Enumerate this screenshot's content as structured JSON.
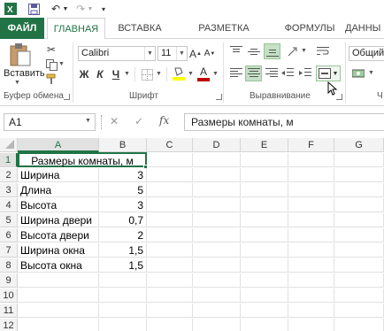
{
  "tabs": {
    "file": "ФАЙЛ",
    "home": "ГЛАВНАЯ",
    "insert": "ВСТАВКА",
    "page_layout": "РАЗМЕТКА СТРАНИЦЫ",
    "formulas": "ФОРМУЛЫ",
    "data": "ДАННЫ"
  },
  "ribbon": {
    "paste_label": "Вставить",
    "clipboard_group": "Буфер обмена",
    "font_group": "Шрифт",
    "alignment_group": "Выравнивание",
    "font_name": "Calibri",
    "font_size": "11",
    "font_grow": "A",
    "font_shrink": "A",
    "bold": "Ж",
    "italic": "К",
    "underline": "Ч",
    "font_color_letter": "A",
    "number_format": "Общий",
    "number_group_initial": "Ч"
  },
  "formula_bar": {
    "name_box": "A1",
    "fx": "fx",
    "cancel": "✕",
    "enter": "✓",
    "content": "Размеры комнаты, м"
  },
  "sheet": {
    "columns": [
      "A",
      "B",
      "C",
      "D",
      "E",
      "F",
      "G"
    ],
    "rows": [
      "1",
      "2",
      "3",
      "4",
      "5",
      "6",
      "7",
      "8",
      "9",
      "10",
      "11",
      "12"
    ],
    "cells": {
      "a1": "Размеры комнаты, м",
      "a2": "Ширина",
      "b2": "3",
      "a3": "Длина",
      "b3": "5",
      "a4": "Высота",
      "b4": "3",
      "a5": "Ширина двери",
      "b5": "0,7",
      "a6": "Высота двери",
      "b6": "2",
      "a7": "Ширина окна",
      "b7": "1,5",
      "a8": "Высота окна",
      "b8": "1,5"
    }
  },
  "colors": {
    "accent": "#217346",
    "fill_highlight": "#ffff00",
    "font_red": "#c00000"
  }
}
